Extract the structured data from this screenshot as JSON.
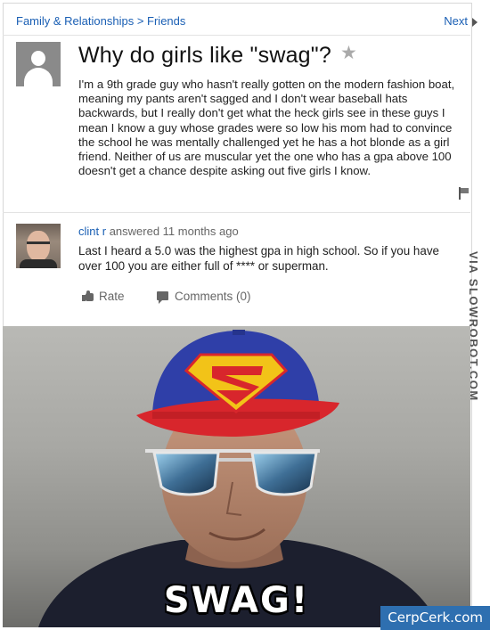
{
  "breadcrumb": {
    "text": "Family & Relationships > Friends"
  },
  "nav": {
    "next": "Next"
  },
  "question": {
    "title": "Why do girls like \"swag\"?",
    "body": "I'm a 9th grade guy who hasn't really gotten on the modern fashion boat, meaning my pants aren't sagged and I don't wear baseball hats backwards, but I really don't get what the heck girls see in these guys I mean I know a guy whose grades were so low his mom had to convince the school he was mentally challenged yet he has a hot blonde as a girl friend. Neither of us are muscular yet the one who has a gpa above 100 doesn't get a chance despite asking out five girls I know."
  },
  "answer": {
    "user": "clint r",
    "meta": "answered 11 months ago",
    "body": "Last I heard a 5.0 was the highest gpa in high school. So if you have over 100 you are either full of **** or superman.",
    "rate_label": "Rate",
    "comments_label": "Comments (0)"
  },
  "watermark": "VIA SLOWROBOT.COM",
  "meme": {
    "caption": "SWAG!"
  },
  "credit": "CerpCerk.com",
  "colors": {
    "link": "#1a5fb4",
    "cap_blue": "#2f3fa8",
    "cap_red": "#d8262c",
    "emblem_yellow": "#f2c318",
    "credit_bg": "#2e6fb0"
  }
}
